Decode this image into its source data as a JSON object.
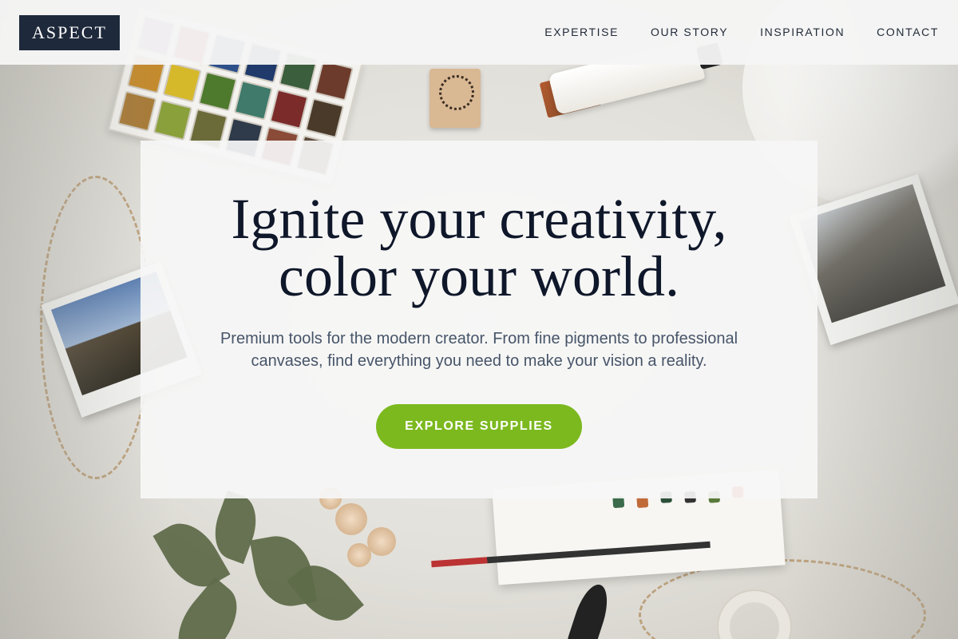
{
  "brand": {
    "logo_text": "ASPECT"
  },
  "nav": {
    "items": [
      {
        "label": "EXPERTISE"
      },
      {
        "label": "OUR STORY"
      },
      {
        "label": "INSPIRATION"
      },
      {
        "label": "CONTACT"
      }
    ]
  },
  "hero": {
    "title_line_1": "Ignite your creativity,",
    "title_line_2": "color your world.",
    "subtitle_line_1": "Premium tools for the modern creator. From fine pigments to professional",
    "subtitle_line_2": "canvases, find everything you need to make your vision a reality.",
    "cta_label": "EXPLORE SUPPLIES"
  },
  "colors": {
    "logo_bg": "#1e293b",
    "heading": "#0f172a",
    "body_text": "#475569",
    "cta_bg": "#7cb91f",
    "header_bg": "#f5f5f5"
  },
  "background": {
    "description_icons": [
      "watercolor-palette",
      "rubber-stamp",
      "paint-tube",
      "polaroid-photo",
      "twine",
      "dried-roses",
      "sketchbook",
      "paint-brush",
      "tape-roll"
    ]
  }
}
